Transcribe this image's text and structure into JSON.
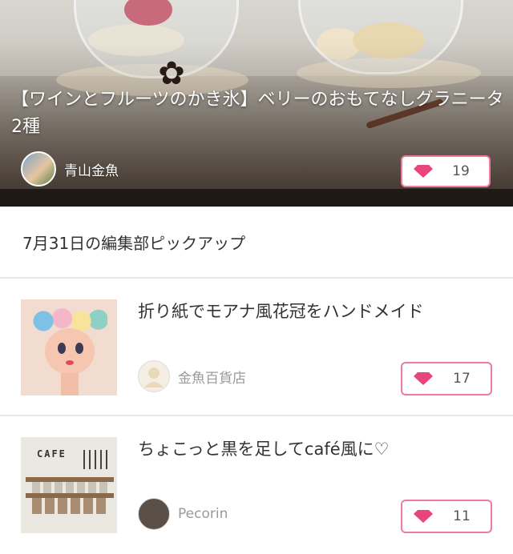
{
  "hero": {
    "title": "【ワインとフルーツのかき氷】ベリーのおもてなしグラニータ2種",
    "author": "青山金魚",
    "likes": "19"
  },
  "section": {
    "title": "7月31日の編集部ピックアップ"
  },
  "articles": [
    {
      "title": "折り紙でモアナ風花冠をハンドメイド",
      "author": "金魚百貨店",
      "likes": "17"
    },
    {
      "title": "ちょこっと黒を足してcafé風に♡",
      "author": "Pecorin",
      "likes": "11",
      "thumb_sign": "CAFE"
    }
  ],
  "icons": {
    "like": "gem-icon"
  },
  "colors": {
    "accent": "#f07aa0",
    "gem": "#e8457f",
    "muted_text": "#9a9a9a",
    "divider": "#e8e8e8"
  }
}
